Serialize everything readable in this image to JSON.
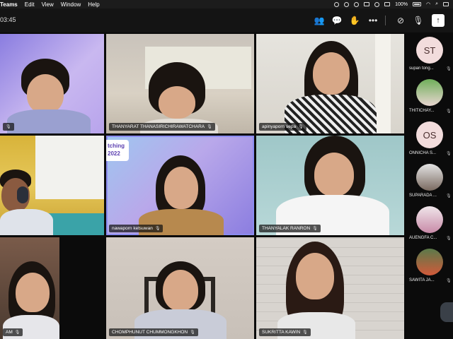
{
  "menubar": {
    "items": [
      "Teams",
      "Edit",
      "View",
      "Window",
      "Help"
    ],
    "battery": "100%"
  },
  "toolbar": {
    "timer": "03:45"
  },
  "tiles": [
    {
      "name": ""
    },
    {
      "name": "THANYARAT THANASIRICHIRAWATCHARA"
    },
    {
      "name": "apinyaporn sepa"
    },
    {
      "name": ""
    },
    {
      "name": "nawaporn ketsuwan",
      "banner_line1": "tching",
      "banner_line2": "2022"
    },
    {
      "name": "THANYALAK RANRON"
    },
    {
      "name": "AM"
    },
    {
      "name": "CHOMPHUNUT CHUMMONGKHON"
    },
    {
      "name": "SUKRITTA KAWIN"
    }
  ],
  "participants": [
    {
      "initials": "ST",
      "name": "supan tong..."
    },
    {
      "initials": "",
      "name": "THITICHAY..."
    },
    {
      "initials": "OS",
      "name": "ONNICHA S..."
    },
    {
      "initials": "",
      "name": "SUPARADA ..."
    },
    {
      "initials": "",
      "name": "AUENGFA C..."
    },
    {
      "initials": "",
      "name": "SAWITA JA..."
    }
  ],
  "colors": {
    "active_border": "#8b8cf0",
    "avatar_bg": "#f2dcdc"
  }
}
